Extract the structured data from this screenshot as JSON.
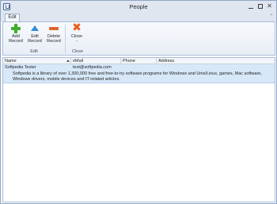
{
  "window": {
    "title": "People"
  },
  "ribbon": {
    "tabs": [
      "Edit"
    ],
    "groups": {
      "edit": {
        "label": "Edit",
        "buttons": {
          "add_line1": "Add",
          "add_line2": "Record",
          "edit_line1": "Edit",
          "edit_line2": "Record",
          "delete_line1": "Delete",
          "delete_line2": "Record"
        }
      },
      "close": {
        "label": "Close",
        "buttons": {
          "close_line1": "Close",
          "close_line2": "-"
        }
      }
    }
  },
  "grid": {
    "columns": [
      "Name",
      "eMail",
      "Phone",
      "Address"
    ],
    "rows": [
      {
        "name": "Softpedia Tester",
        "email": "test@softpedia.com",
        "phone": "",
        "address": "",
        "preview": "Softpedia is a library of over 1,300,000 free and free-to-try software programs for Windows and Unix/Linux, games, Mac software, Windows drivers, mobile devices and IT-related articles."
      }
    ]
  },
  "colors": {
    "accent": "#2f8fd8",
    "add": "#3fae2a",
    "delete": "#e0632a",
    "close": "#e85d1f",
    "selected_row": "#d7e8f8"
  },
  "icons": {
    "app": "app-icon",
    "add": "plus-icon",
    "edit": "triangle-up-icon",
    "delete": "minus-icon",
    "close": "x-icon"
  }
}
